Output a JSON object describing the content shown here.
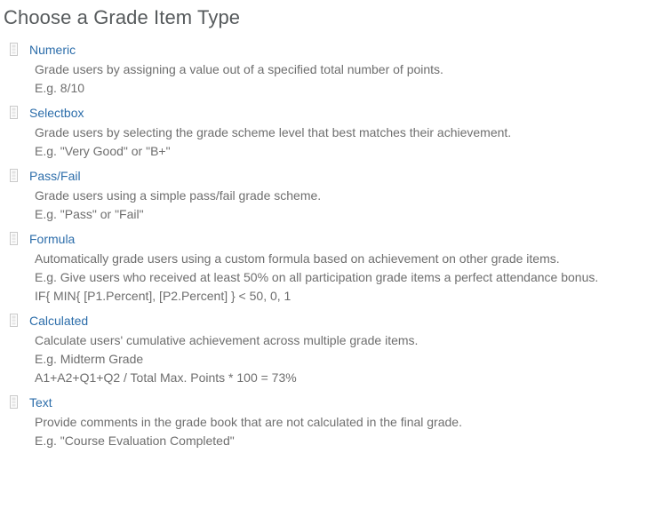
{
  "page": {
    "title": "Choose a Grade Item Type",
    "background_color": "#ffffff",
    "title_color": "#565a5c",
    "link_color": "#2c6daa",
    "text_color": "#6e6e6e"
  },
  "grade_item_types": [
    {
      "icon": "broken-image-icon",
      "name": "Numeric",
      "lines": [
        "Grade users by assigning a value out of a specified total number of points.",
        "E.g. 8/10"
      ]
    },
    {
      "icon": "broken-image-icon",
      "name": "Selectbox",
      "lines": [
        "Grade users by selecting the grade scheme level that best matches their achievement.",
        "E.g. \"Very Good\" or \"B+\""
      ]
    },
    {
      "icon": "broken-image-icon",
      "name": "Pass/Fail",
      "lines": [
        "Grade users using a simple pass/fail grade scheme.",
        "E.g. \"Pass\" or \"Fail\""
      ]
    },
    {
      "icon": "broken-image-icon",
      "name": "Formula",
      "lines": [
        "Automatically grade users using a custom formula based on achievement on other grade items.",
        "E.g. Give users who received at least 50% on all participation grade items a perfect attendance bonus.",
        "IF{ MIN{ [P1.Percent], [P2.Percent] } < 50, 0, 1"
      ]
    },
    {
      "icon": "broken-image-icon",
      "name": "Calculated",
      "lines": [
        "Calculate users' cumulative achievement across multiple grade items.",
        "E.g. Midterm Grade",
        "A1+A2+Q1+Q2 / Total Max. Points * 100 = 73%"
      ]
    },
    {
      "icon": "broken-image-icon",
      "name": "Text",
      "lines": [
        "Provide comments in the grade book that are not calculated in the final grade.",
        "E.g. \"Course Evaluation Completed\""
      ]
    }
  ]
}
